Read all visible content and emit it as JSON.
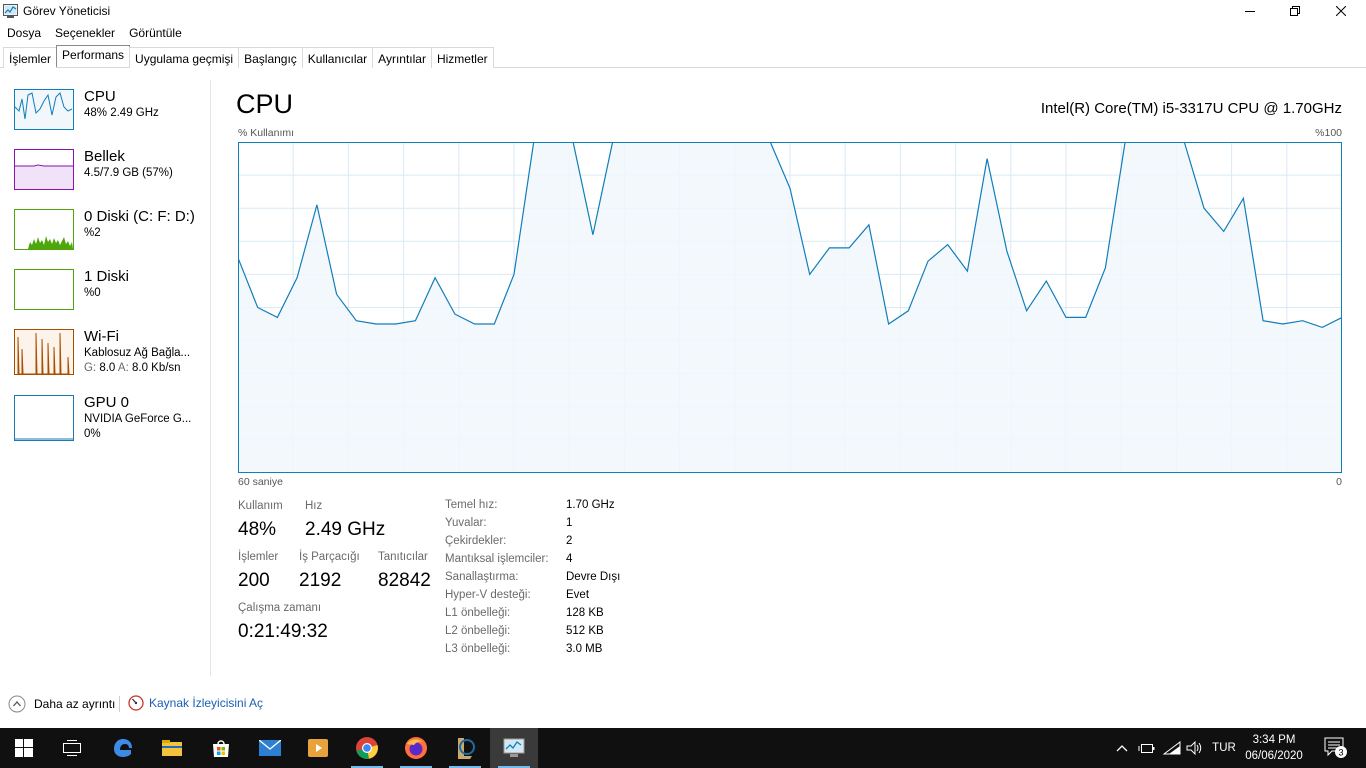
{
  "window": {
    "title": "Görev Yöneticisi"
  },
  "menu": [
    "Dosya",
    "Seçenekler",
    "Görüntüle"
  ],
  "tabs": [
    "İşlemler",
    "Performans",
    "Uygulama geçmişi",
    "Başlangıç",
    "Kullanıcılar",
    "Ayrıntılar",
    "Hizmetler"
  ],
  "active_tab": "Performans",
  "sidebar": [
    {
      "title": "CPU",
      "line1": "48% 2.49 GHz",
      "color": "#117dbb"
    },
    {
      "title": "Bellek",
      "line1": "4.5/7.9 GB (57%)",
      "color": "#8b12ae"
    },
    {
      "title": "0 Diski (C: F: D:)",
      "line1": "%2",
      "color": "#4da60c"
    },
    {
      "title": "1 Diski",
      "line1": "%0",
      "color": "#4da60c"
    },
    {
      "title": "Wi-Fi",
      "line1": "Kablosuz Ağ Bağla...",
      "line2_g_label": "G:",
      "line2_g_value": "8.0",
      "line2_a_label": "A:",
      "line2_a_value": "8.0 Kb/sn",
      "color": "#a74f01"
    },
    {
      "title": "GPU 0",
      "line1": "NVIDIA GeForce G...",
      "line2": "0%",
      "color": "#1a7bb4"
    }
  ],
  "main": {
    "title": "CPU",
    "cpu_model": "Intel(R) Core(TM) i5-3317U CPU @ 1.70GHz",
    "y_axis_label": "% Kullanımı",
    "y_axis_max": "%100",
    "x_axis_label": "60 saniye",
    "x_axis_min": "0"
  },
  "chart_data": {
    "type": "area",
    "title": "CPU",
    "ylabel": "% Kullanımı",
    "xlabel": "60 saniye",
    "ylim": [
      0,
      100
    ],
    "xlim": [
      60,
      0
    ],
    "grid": true,
    "series": [
      {
        "values": [
          65,
          50,
          47,
          59,
          81,
          54,
          46,
          45,
          45,
          46,
          59,
          48,
          45,
          45,
          60,
          100,
          100,
          100,
          72,
          100,
          100,
          100,
          100,
          100,
          100,
          100,
          100,
          100,
          86,
          60,
          68,
          68,
          75,
          45,
          49,
          64,
          69,
          61,
          95,
          67,
          49,
          58,
          47,
          47,
          62,
          100,
          100,
          100,
          100,
          80,
          73,
          83,
          46,
          45,
          46,
          44,
          47
        ]
      }
    ]
  },
  "stats": {
    "utilization_label": "Kullanım",
    "utilization_value": "48%",
    "speed_label": "Hız",
    "speed_value": "2.49 GHz",
    "processes_label": "İşlemler",
    "processes_value": "200",
    "threads_label": "İş Parçacığı",
    "threads_value": "2192",
    "handles_label": "Tanıtıcılar",
    "handles_value": "82842",
    "uptime_label": "Çalışma zamanı",
    "uptime_value": "0:21:49:32"
  },
  "specs": [
    {
      "label": "Temel hız:",
      "value": "1.70 GHz"
    },
    {
      "label": "Yuvalar:",
      "value": "1"
    },
    {
      "label": "Çekirdekler:",
      "value": "2"
    },
    {
      "label": "Mantıksal işlemciler:",
      "value": "4"
    },
    {
      "label": "Sanallaştırma:",
      "value": "Devre Dışı"
    },
    {
      "label": "Hyper-V desteği:",
      "value": "Evet"
    },
    {
      "label": "L1 önbelleği:",
      "value": "128 KB"
    },
    {
      "label": "L2 önbelleği:",
      "value": "512 KB"
    },
    {
      "label": "L3 önbelleği:",
      "value": "3.0 MB"
    }
  ],
  "footer": {
    "less_detail": "Daha az ayrıntı",
    "resource_monitor": "Kaynak İzleyicisini Aç"
  },
  "taskbar": {
    "apps": [
      "start-icon",
      "task-view-icon",
      "edge-icon",
      "file-explorer-icon",
      "store-icon",
      "mail-icon",
      "media-player-icon",
      "chrome-icon",
      "firefox-icon",
      "league-icon",
      "task-manager-icon"
    ],
    "language": "TUR",
    "time": "3:34 PM",
    "date": "06/06/2020",
    "notifications": "3"
  }
}
